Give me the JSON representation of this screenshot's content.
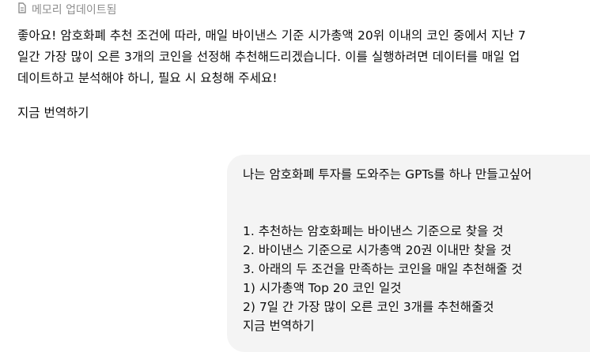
{
  "memory_notice": {
    "label": "메모리 업데이트됨",
    "icon": "memory-update-icon"
  },
  "assistant": {
    "paragraph_lines": [
      "좋아요! 암호화폐 추천 조건에 따라, 매일 바이낸스 기준 시가총액 20위 이내의 코인 중에서 지난 7",
      "일간 가장 많이 오른 3개의 코인을 선정해 추천해드리겠습니다. 이를 실행하려면 데이터를 매일 업",
      "데이트하고 분석해야 하니, 필요 시 요청해 주세요!"
    ],
    "translate_label": "지금 번역하기"
  },
  "user": {
    "intro": "나는 암호화폐 투자를 도와주는 GPTs를 하나 만들고싶어",
    "items": [
      "1. 추천하는 암호화폐는 바이낸스 기준으로 찾을 것",
      "2. 바이낸스 기준으로 시가총액 20권 이내만 찾을 것",
      "3. 아래의 두 조건을 만족하는 코인을 매일 추천해줄 것",
      "1) 시가총액 Top 20 코인 일것",
      "2) 7일 간 가장 많이 오른 코인 3개를 추천해줄것"
    ],
    "translate_label": "지금 번역하기"
  },
  "colors": {
    "muted_text": "#8e8e8e",
    "bubble_bg": "#f4f4f4",
    "text": "#0d0d0d"
  }
}
